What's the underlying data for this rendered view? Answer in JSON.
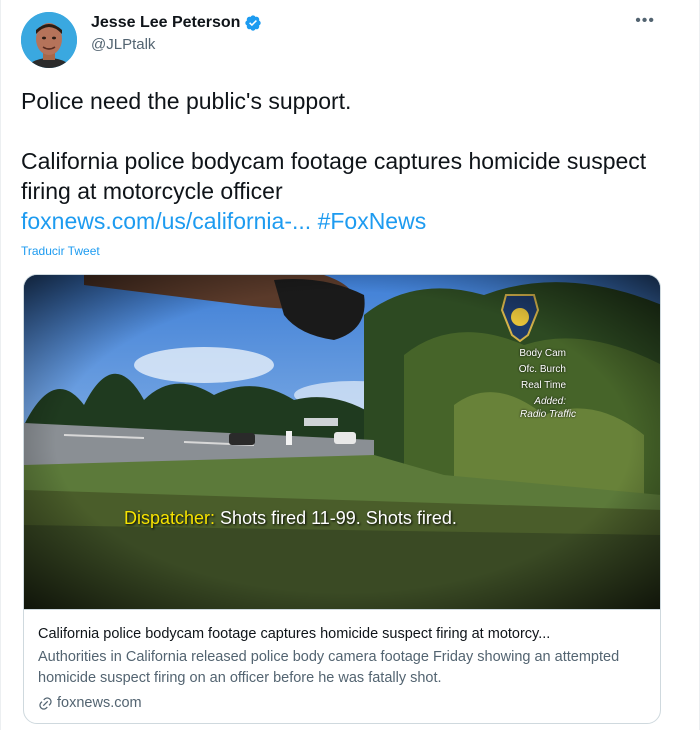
{
  "author": {
    "display_name": "Jesse Lee Peterson",
    "handle": "@JLPtalk",
    "verified": true
  },
  "more_icon": "more-horizontal-icon",
  "tweet": {
    "line1": "Police need the public's support.",
    "line2": "California police bodycam footage captures homicide suspect firing at motorcycle officer",
    "link": "foxnews.com/us/california-...",
    "hashtag": "#FoxNews",
    "translate_label": "Traducir Tweet"
  },
  "card": {
    "media": {
      "overlay_lines": [
        "Body Cam",
        "Ofc. Burch",
        "Real Time",
        "Added:",
        "Radio Traffic"
      ],
      "subtitle_speaker": "Dispatcher:",
      "subtitle_text": " Shots fired 11-99. Shots fired."
    },
    "title": "California police bodycam footage captures homicide suspect firing at motorcy...",
    "description": "Authorities in California released police body camera footage Friday showing an attempted homicide suspect firing on an officer before he was fatally shot.",
    "domain": "foxnews.com"
  },
  "colors": {
    "link": "#1d9bf0",
    "secondary_text": "#536471",
    "subtitle_speaker": "#f6e300"
  }
}
